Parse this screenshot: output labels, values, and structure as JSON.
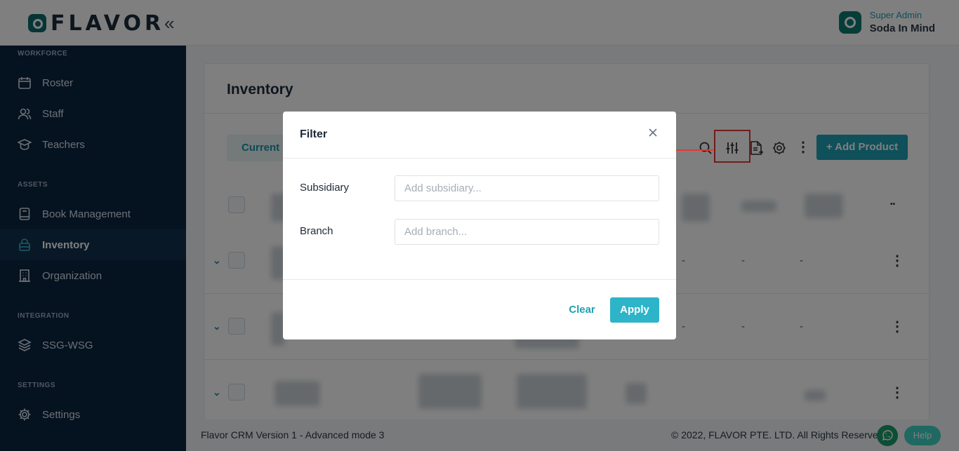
{
  "header": {
    "logo_text": "FLAVOR",
    "collapse_icon": "«",
    "user_role": "Super Admin",
    "user_name": "Soda In Mind"
  },
  "sidebar": {
    "sections": [
      {
        "title": "WORKFORCE",
        "items": [
          {
            "label": "Roster",
            "icon": "calendar-icon"
          },
          {
            "label": "Staff",
            "icon": "users-icon"
          },
          {
            "label": "Teachers",
            "icon": "graduation-cap-icon"
          }
        ]
      },
      {
        "title": "ASSETS",
        "items": [
          {
            "label": "Book Management",
            "icon": "book-icon"
          },
          {
            "label": "Inventory",
            "icon": "inventory-icon",
            "active": true
          },
          {
            "label": "Organization",
            "icon": "building-icon"
          }
        ]
      },
      {
        "title": "INTEGRATION",
        "items": [
          {
            "label": "SSG-WSG",
            "icon": "layers-icon"
          }
        ]
      },
      {
        "title": "SETTINGS",
        "items": [
          {
            "label": "Settings",
            "icon": "gear-icon"
          }
        ]
      }
    ]
  },
  "main": {
    "page_title": "Inventory",
    "current_tab": "Current",
    "add_product_label": "+ Add Product",
    "row_dash": "-"
  },
  "modal": {
    "title": "Filter",
    "fields": [
      {
        "label": "Subsidiary",
        "placeholder": "Add subsidiary..."
      },
      {
        "label": "Branch",
        "placeholder": "Add branch..."
      }
    ],
    "clear_label": "Clear",
    "apply_label": "Apply"
  },
  "footer": {
    "version": "Flavor CRM Version 1 - Advanced mode 3",
    "copyright": "© 2022, FLAVOR PTE. LTD. All Rights Reserved.",
    "help_label": "Help"
  },
  "colors": {
    "sidebar_bg": "#0b2540",
    "accent": "#1fa0b5",
    "highlight": "#e53935"
  }
}
